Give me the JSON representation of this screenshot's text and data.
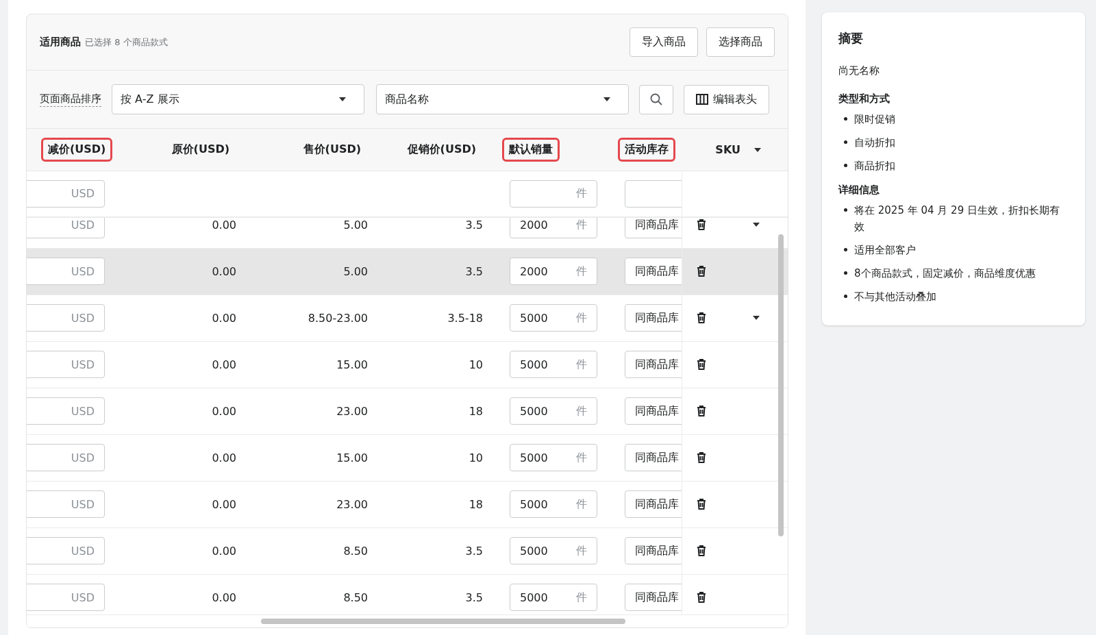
{
  "card": {
    "title": "适用商品",
    "subtitle": "已选择 8 个商品款式",
    "buttons": [
      "导入商品",
      "选择商品"
    ]
  },
  "filters": {
    "sort_label": "页面商品排序",
    "sort_select": "按 A-Z 展示",
    "field_select": "商品名称",
    "edit_columns_button": "编辑表头"
  },
  "table": {
    "columns": [
      {
        "label": "减价(USD)",
        "marked": true,
        "dropdown": false
      },
      {
        "label": "原价(USD)",
        "marked": false,
        "dropdown": false
      },
      {
        "label": "售价(USD)",
        "marked": false,
        "dropdown": false
      },
      {
        "label": "促销价(USD)",
        "marked": false,
        "dropdown": false
      },
      {
        "label": "默认销量",
        "marked": true,
        "dropdown": false
      },
      {
        "label": "活动库存",
        "marked": true,
        "dropdown": false
      },
      {
        "label": "SKU",
        "marked": false,
        "dropdown": true
      }
    ],
    "bulk_row": {
      "discount_suffix": "USD",
      "quantity_suffix": "件"
    },
    "rows": [
      {
        "discount_suffix": "USD",
        "original": "0.00",
        "price": "5.00",
        "promo": "3.5",
        "quantity": "2000",
        "quantity_suffix": "件",
        "stock": "同商品库",
        "has_variants": true,
        "highlighted": false
      },
      {
        "discount_suffix": "USD",
        "original": "0.00",
        "price": "5.00",
        "promo": "3.5",
        "quantity": "2000",
        "quantity_suffix": "件",
        "stock": "同商品库",
        "has_variants": false,
        "highlighted": true
      },
      {
        "discount_suffix": "USD",
        "original": "0.00",
        "price": "8.50-23.00",
        "promo": "3.5-18",
        "quantity": "5000",
        "quantity_suffix": "件",
        "stock": "同商品库",
        "has_variants": true,
        "highlighted": false
      },
      {
        "discount_suffix": "USD",
        "original": "0.00",
        "price": "15.00",
        "promo": "10",
        "quantity": "5000",
        "quantity_suffix": "件",
        "stock": "同商品库",
        "has_variants": false,
        "highlighted": false
      },
      {
        "discount_suffix": "USD",
        "original": "0.00",
        "price": "23.00",
        "promo": "18",
        "quantity": "5000",
        "quantity_suffix": "件",
        "stock": "同商品库",
        "has_variants": false,
        "highlighted": false
      },
      {
        "discount_suffix": "USD",
        "original": "0.00",
        "price": "15.00",
        "promo": "10",
        "quantity": "5000",
        "quantity_suffix": "件",
        "stock": "同商品库",
        "has_variants": false,
        "highlighted": false
      },
      {
        "discount_suffix": "USD",
        "original": "0.00",
        "price": "23.00",
        "promo": "18",
        "quantity": "5000",
        "quantity_suffix": "件",
        "stock": "同商品库",
        "has_variants": false,
        "highlighted": false
      },
      {
        "discount_suffix": "USD",
        "original": "0.00",
        "price": "8.50",
        "promo": "3.5",
        "quantity": "5000",
        "quantity_suffix": "件",
        "stock": "同商品库",
        "has_variants": false,
        "highlighted": false
      },
      {
        "discount_suffix": "USD",
        "original": "0.00",
        "price": "8.50",
        "promo": "3.5",
        "quantity": "5000",
        "quantity_suffix": "件",
        "stock": "同商品库",
        "has_variants": false,
        "highlighted": false
      }
    ]
  },
  "summary": {
    "title": "摘要",
    "name": "尚无名称",
    "sections": [
      {
        "heading": "类型和方式",
        "items": [
          "限时促销",
          "自动折扣",
          "商品折扣"
        ]
      },
      {
        "heading": "详细信息",
        "items": [
          "将在 2025 年 04 月 29 日生效，折扣长期有效",
          "适用全部客户",
          "8个商品款式，固定减价，商品维度优惠",
          "不与其他活动叠加"
        ]
      }
    ]
  }
}
